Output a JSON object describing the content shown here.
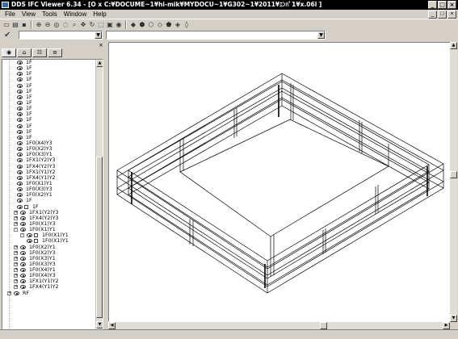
{
  "window": {
    "title": "DDS IFC Viewer 6.34 - [O x  C:¥DOCUME~1¥hi-mik¥MYDOCU~1¥G302~1¥2011¥ｴﾝﾊﾟ1¥x.06l ]",
    "minimize": "_",
    "maximize": "□",
    "close": "×"
  },
  "menu": {
    "items": [
      "File",
      "View",
      "Tools",
      "Window",
      "Help"
    ]
  },
  "combos": {
    "left_value": "",
    "right_value": ""
  },
  "panel": {
    "close_glyph": "×",
    "tabs": [
      "◉",
      "⌂",
      "☷",
      "≡"
    ]
  },
  "tree": {
    "rows": [
      {
        "label": "1F",
        "indent": 3
      },
      {
        "label": "1F",
        "indent": 3
      },
      {
        "label": "1F",
        "indent": 3
      },
      {
        "label": "1F",
        "indent": 3
      },
      {
        "label": "1F",
        "indent": 3
      },
      {
        "label": "1F",
        "indent": 3
      },
      {
        "label": "1F",
        "indent": 3
      },
      {
        "label": "1F",
        "indent": 3
      },
      {
        "label": "1F",
        "indent": 3
      },
      {
        "label": "1F",
        "indent": 3
      },
      {
        "label": "1F",
        "indent": 3
      },
      {
        "label": "1F",
        "indent": 3
      },
      {
        "label": "1F",
        "indent": 3
      },
      {
        "label": "1F",
        "indent": 3
      },
      {
        "label": "1F0(X4)Y3",
        "indent": 3
      },
      {
        "label": "1F0(X2)Y3",
        "indent": 3
      },
      {
        "label": "1F0(X3)Y1",
        "indent": 3
      },
      {
        "label": "1FX1(Y2)Y3",
        "indent": 3
      },
      {
        "label": "1FX4(Y2)Y3",
        "indent": 3
      },
      {
        "label": "1FX1(Y1)Y2",
        "indent": 3
      },
      {
        "label": "1FX4(Y1)Y2",
        "indent": 3
      },
      {
        "label": "1F0(X1)Y1",
        "indent": 3
      },
      {
        "label": "1F0(X3)Y3",
        "indent": 3
      },
      {
        "label": "1F0(X2)Y1",
        "indent": 3
      },
      {
        "label": "1F",
        "indent": 3
      },
      {
        "label": "1F",
        "indent": 3,
        "icon": true
      },
      {
        "label": "1FX1(Y2)Y3",
        "indent": 2,
        "exp": "+"
      },
      {
        "label": "1FX4(Y2)Y3",
        "indent": 2,
        "exp": "+"
      },
      {
        "label": "1F0(X1)Y3",
        "indent": 2,
        "exp": "+"
      },
      {
        "label": "1F0(X1)Y1",
        "indent": 2,
        "exp": "-"
      },
      {
        "label": "1F0(X1)Y1",
        "indent": 4,
        "exp": "-",
        "icon": true
      },
      {
        "label": "1F0(X1)Y1",
        "indent": 6,
        "icon": true
      },
      {
        "label": "1F0(X2)Y1",
        "indent": 2,
        "exp": "+"
      },
      {
        "label": "1F0(X2)Y3",
        "indent": 2,
        "exp": "+"
      },
      {
        "label": "1F0(X3)Y1",
        "indent": 2,
        "exp": "+"
      },
      {
        "label": "1F0(X3)Y3",
        "indent": 2,
        "exp": "+"
      },
      {
        "label": "1F0(X4)Y1",
        "indent": 2,
        "exp": "+"
      },
      {
        "label": "1F0(X4)Y3",
        "indent": 2,
        "exp": "+"
      },
      {
        "label": "1FX1(Y1)Y2",
        "indent": 2,
        "exp": "+"
      },
      {
        "label": "1FX4(Y1)Y2",
        "indent": 2,
        "exp": "+"
      },
      {
        "label": "RF",
        "indent": 0,
        "exp": "+"
      }
    ]
  }
}
